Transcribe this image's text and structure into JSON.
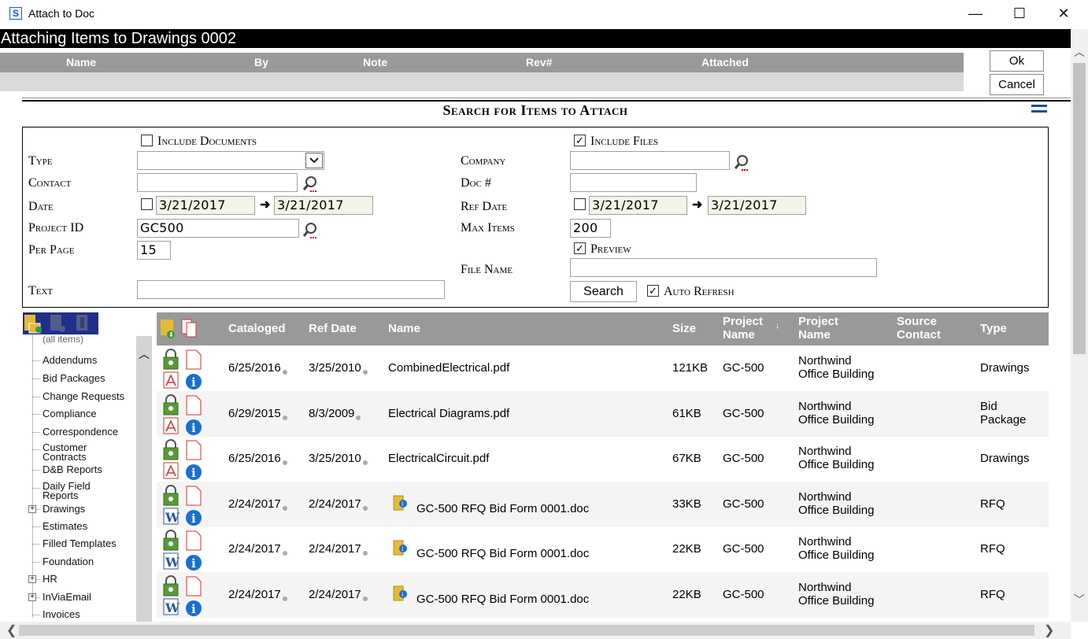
{
  "window": {
    "title": "Attach to Doc",
    "app_icon": "S",
    "minimize": "—",
    "maximize": "☐",
    "close": "✕"
  },
  "header": {
    "title": "Attaching Items to Drawings 0002"
  },
  "attached": {
    "columns": [
      "Name",
      "By",
      "Note",
      "Rev#",
      "Attached"
    ],
    "ok_label": "Ok",
    "cancel_label": "Cancel"
  },
  "search": {
    "title": "Search for Items to Attach",
    "include_documents_label": "Include Documents",
    "include_documents_checked": false,
    "include_files_label": "Include Files",
    "include_files_checked": true,
    "type_label": "Type",
    "type_value": "",
    "contact_label": "Contact",
    "contact_value": "",
    "date_label": "Date",
    "date_checked": false,
    "date_from": "3/21/2017",
    "date_to": "3/21/2017",
    "project_id_label": "Project ID",
    "project_id_value": "GC500",
    "per_page_label": "Per Page",
    "per_page_value": "15",
    "text_label": "Text",
    "text_value": "",
    "company_label": "Company",
    "company_value": "",
    "doc_no_label": "Doc #",
    "doc_no_value": "",
    "ref_date_label": "Ref Date",
    "ref_date_checked": false,
    "ref_date_from": "3/21/2017",
    "ref_date_to": "3/21/2017",
    "max_items_label": "Max Items",
    "max_items_value": "200",
    "preview_label": "Preview",
    "preview_checked": true,
    "file_name_label": "File Name",
    "file_name_value": "",
    "search_button": "Search",
    "auto_refresh_label": "Auto Refresh",
    "auto_refresh_checked": true,
    "check_mark": "✓"
  },
  "tree": {
    "all_items": "(all items)",
    "items": [
      "Addendums",
      "Bid Packages",
      "Change Requests",
      "Compliance",
      "Correspondence",
      "Customer Contracts",
      "D&B Reports",
      "Daily Field Reports",
      "Drawings",
      "Estimates",
      "Filled Templates",
      "Foundation",
      "HR",
      "InViaEmail",
      "Invoices"
    ],
    "expandable": [
      "Drawings",
      "HR",
      "InViaEmail"
    ]
  },
  "grid": {
    "columns": {
      "cataloged": "Cataloged",
      "ref_date": "Ref Date",
      "name": "Name",
      "size": "Size",
      "project_name_1": "Project Name",
      "sort_indicator": "↓",
      "project_name_2": "Project Name",
      "source_contact": "Source Contact",
      "type": "Type"
    },
    "rows": [
      {
        "cataloged": "6/25/2016",
        "ref_date": "3/25/2010",
        "name": "CombinedElectrical.pdf",
        "size": "121KB",
        "project": "GC-500",
        "project_name_1": "Northwind",
        "project_name_2": "Office Building",
        "source_contact": "",
        "type_1": "Drawings",
        "type_2": "",
        "file_icon": "pdf-icon",
        "folder_icon": false
      },
      {
        "cataloged": "6/29/2015",
        "ref_date": "8/3/2009",
        "name": "Electrical Diagrams.pdf",
        "size": "61KB",
        "project": "GC-500",
        "project_name_1": "Northwind",
        "project_name_2": "Office Building",
        "source_contact": "",
        "type_1": "Bid",
        "type_2": "Package",
        "file_icon": "pdf-icon",
        "folder_icon": false
      },
      {
        "cataloged": "6/25/2016",
        "ref_date": "3/25/2010",
        "name": "ElectricalCircuit.pdf",
        "size": "67KB",
        "project": "GC-500",
        "project_name_1": "Northwind",
        "project_name_2": "Office Building",
        "source_contact": "",
        "type_1": "Drawings",
        "type_2": "",
        "file_icon": "pdf-icon",
        "folder_icon": false
      },
      {
        "cataloged": "2/24/2017",
        "ref_date": "2/24/2017",
        "name": "GC-500 RFQ Bid Form 0001.doc",
        "size": "33KB",
        "project": "GC-500",
        "project_name_1": "Northwind",
        "project_name_2": "Office Building",
        "source_contact": "",
        "type_1": "RFQ",
        "type_2": "",
        "file_icon": "word-icon",
        "folder_icon": true
      },
      {
        "cataloged": "2/24/2017",
        "ref_date": "2/24/2017",
        "name": "GC-500 RFQ Bid Form 0001.doc",
        "size": "22KB",
        "project": "GC-500",
        "project_name_1": "Northwind",
        "project_name_2": "Office Building",
        "source_contact": "",
        "type_1": "RFQ",
        "type_2": "",
        "file_icon": "word-icon",
        "folder_icon": true
      },
      {
        "cataloged": "2/24/2017",
        "ref_date": "2/24/2017",
        "name": "GC-500 RFQ Bid Form 0001.doc",
        "size": "22KB",
        "project": "GC-500",
        "project_name_1": "Northwind",
        "project_name_2": "Office Building",
        "source_contact": "",
        "type_1": "RFQ",
        "type_2": "",
        "file_icon": "word-icon",
        "folder_icon": true
      }
    ]
  },
  "colors": {
    "header_bg": "#000000",
    "grid_header_bg": "#999999",
    "tree_header_bg": "#1f2f8a",
    "accent_blue": "#1f4e9c"
  }
}
